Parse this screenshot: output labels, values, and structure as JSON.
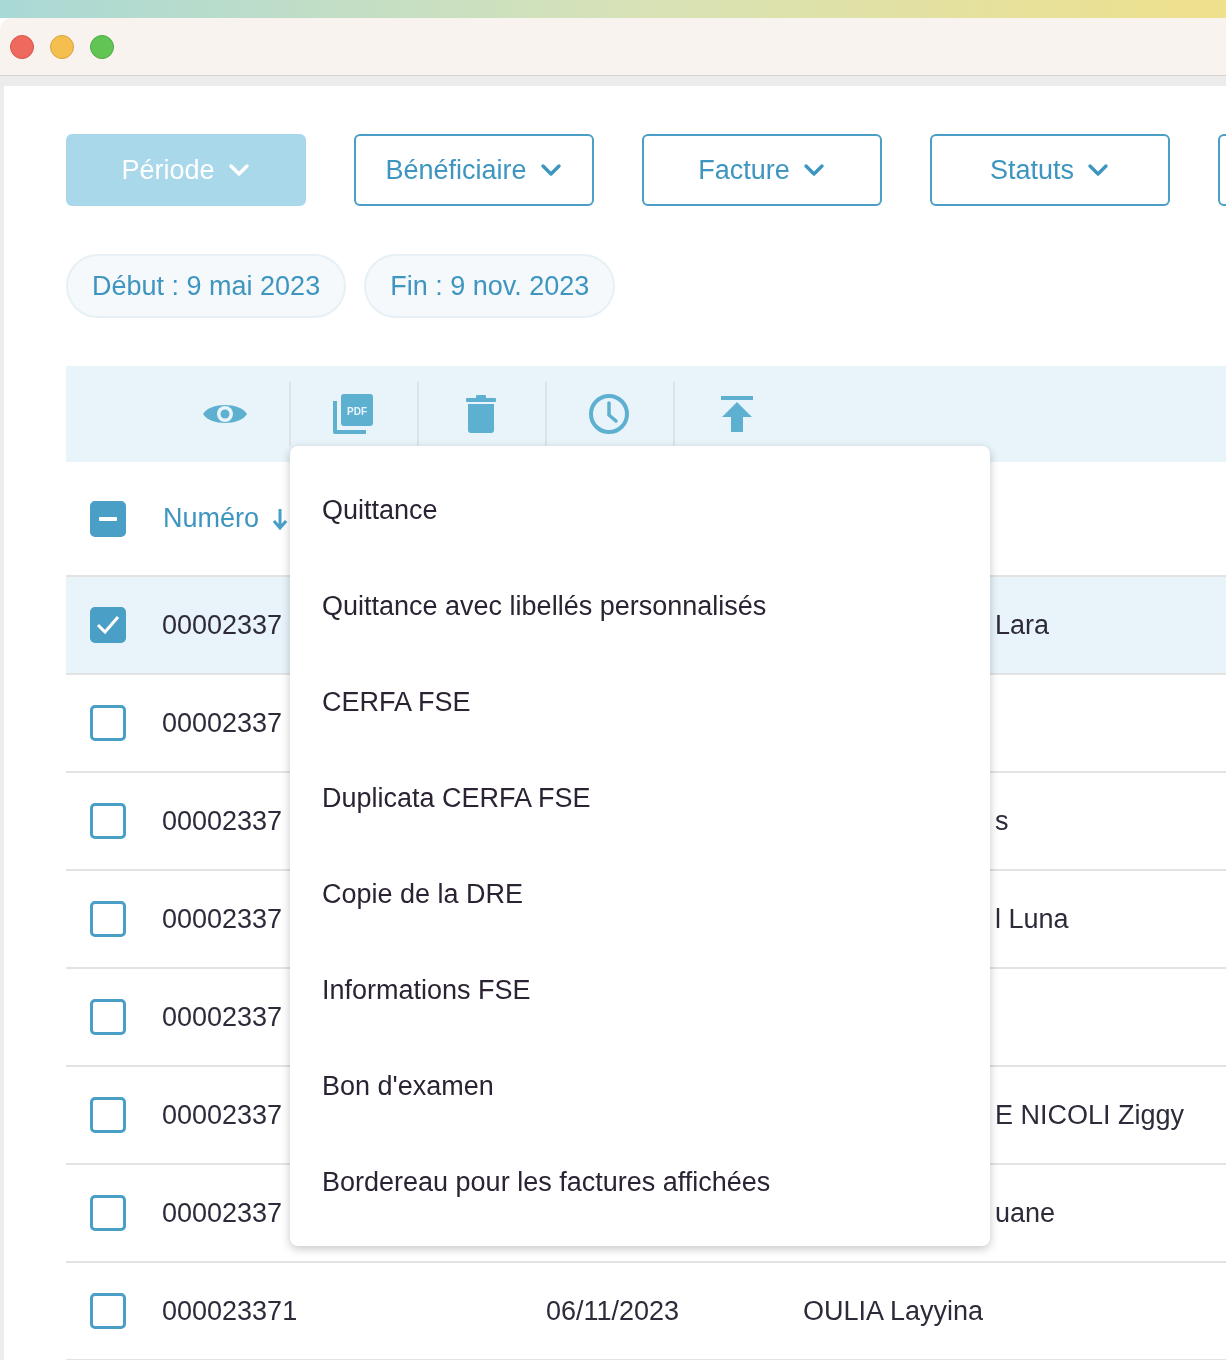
{
  "filters": [
    {
      "kind": "button",
      "label": "Période",
      "active": true
    },
    {
      "kind": "button",
      "label": "Bénéficiaire",
      "active": false
    },
    {
      "kind": "button",
      "label": "Facture",
      "active": false
    },
    {
      "kind": "button",
      "label": "Statuts",
      "active": false
    },
    {
      "kind": "cut",
      "active": false
    }
  ],
  "date_chips": [
    "Début : 9 mai 2023",
    "Fin : 9 nov. 2023"
  ],
  "toolbar": {
    "pdf_icon_label": "PDF"
  },
  "table": {
    "header": {
      "indeterminate": true,
      "column_1": {
        "label": "Numéro",
        "sorted_desc": true
      }
    },
    "rows": [
      {
        "kind": "partial",
        "selected": true,
        "number": "00002337",
        "beneficiary": "Lara"
      },
      {
        "kind": "partial",
        "selected": false,
        "number": "00002337"
      },
      {
        "kind": "partial",
        "selected": false,
        "number": "00002337",
        "beneficiary": "s"
      },
      {
        "kind": "partial",
        "selected": false,
        "number": "00002337",
        "beneficiary": "l Luna"
      },
      {
        "kind": "partial",
        "selected": false,
        "number": "00002337"
      },
      {
        "kind": "partial",
        "selected": false,
        "number": "00002337",
        "beneficiary": "E NICOLI Ziggy"
      },
      {
        "kind": "partial",
        "selected": false,
        "number": "00002337",
        "beneficiary": "uane"
      },
      {
        "kind": "full",
        "selected": false,
        "number": "000023371",
        "date": "06/11/2023",
        "beneficiary": "OULIA Layyina"
      }
    ]
  },
  "pdf_menu": {
    "items": [
      "Quittance",
      "Quittance avec libellés personnalisés",
      "CERFA FSE",
      "Duplicata CERFA FSE",
      "Copie de la DRE",
      "Informations FSE",
      "Bon d'examen",
      "Bordereau pour les factures affichées"
    ]
  }
}
